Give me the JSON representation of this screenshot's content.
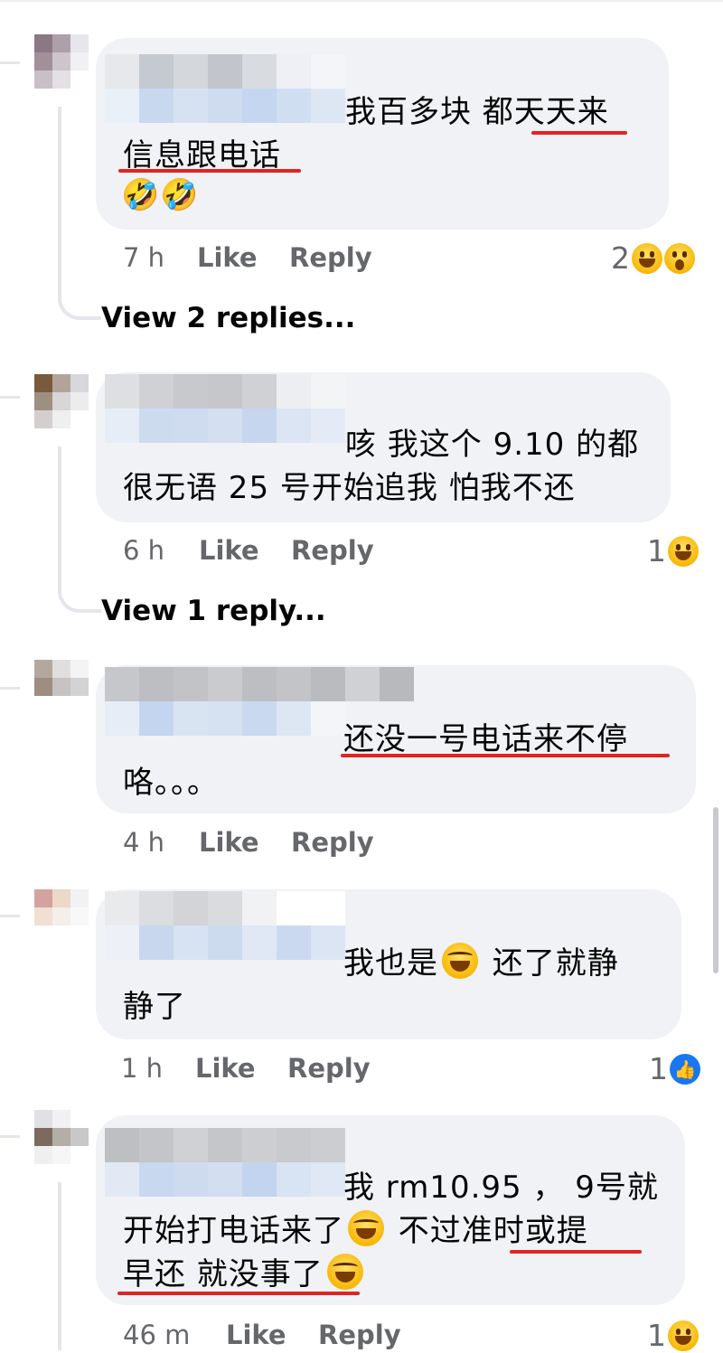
{
  "comments": [
    {
      "id": "c1",
      "text_line1": "我百多块 都天天来",
      "text_line2": "信息跟电话",
      "text_line3": "🤣🤣",
      "time": "7 h",
      "like": "Like",
      "reply": "Reply",
      "reaction_count": "2",
      "reactions": [
        "haha-icon",
        "wow-icon"
      ],
      "view_replies": "View 2 replies..."
    },
    {
      "id": "c2",
      "text_line1": "咳 我这个 9.10 的都",
      "text_line2": "很无语 25 号开始追我 怕我不还",
      "time": "6 h",
      "like": "Like",
      "reply": "Reply",
      "reaction_count": "1",
      "reactions": [
        "haha-icon"
      ],
      "view_replies": "View 1 reply..."
    },
    {
      "id": "c3",
      "text_line1": "还没一号电话来不停",
      "text_line2": "咯。。。",
      "time": "4 h",
      "like": "Like",
      "reply": "Reply"
    },
    {
      "id": "c4",
      "text_line1_a": "我也是",
      "text_line1_b": " 还了就静",
      "text_line2": "静了",
      "time": "1 h",
      "like": "Like",
      "reply": "Reply",
      "reaction_count": "1",
      "reactions": [
        "like-icon"
      ]
    },
    {
      "id": "c5",
      "text_line1": "我 rm10.95 ， 9号就",
      "text_line2_a": "开始打电话来了",
      "text_line2_b": " 不过准时或提",
      "text_line3": "早还 就没事了",
      "time": "46 m",
      "like": "Like",
      "reply": "Reply",
      "reaction_count": "1",
      "reactions": [
        "haha-icon"
      ]
    }
  ],
  "colors": {
    "bubble": "#f0f2f5",
    "meta": "#65676b",
    "underline": "#e02424",
    "like_blue": "#1877f2"
  }
}
